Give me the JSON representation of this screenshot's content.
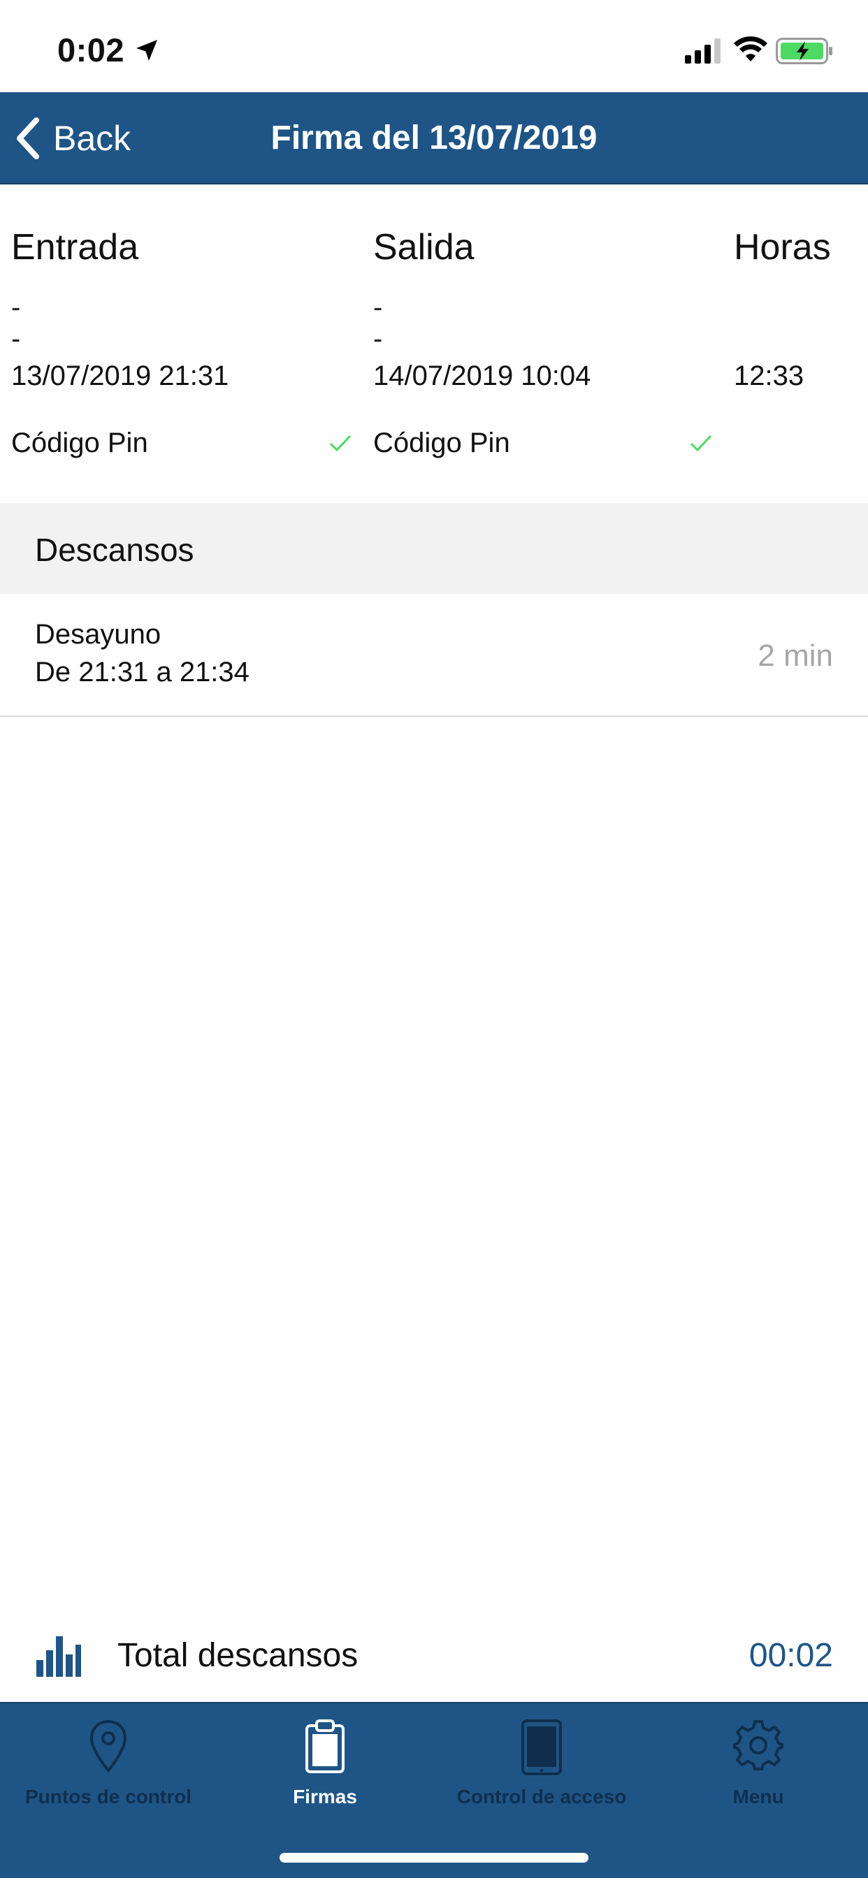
{
  "status_bar": {
    "time": "0:02"
  },
  "nav": {
    "back_label": "Back",
    "title": "Firma del 13/07/2019"
  },
  "entry": {
    "heading": "Entrada",
    "dash": "--",
    "datetime": "13/07/2019 21:31",
    "method": "Código Pin"
  },
  "exit": {
    "heading": "Salida",
    "dash": "--",
    "datetime": "14/07/2019 10:04",
    "method": "Código Pin"
  },
  "hours": {
    "heading": "Horas",
    "value": "12:33"
  },
  "breaks": {
    "section_title": "Descansos",
    "items": [
      {
        "name": "Desayuno",
        "range": "De 21:31 a 21:34",
        "duration": "2 min"
      }
    ]
  },
  "totals": {
    "label": "Total descansos",
    "value": "00:02"
  },
  "tabs": [
    {
      "label": "Puntos de control",
      "icon": "location-pin-icon",
      "active": false
    },
    {
      "label": "Firmas",
      "icon": "clipboard-icon",
      "active": true
    },
    {
      "label": "Control de acceso",
      "icon": "tablet-icon",
      "active": false
    },
    {
      "label": "Menu",
      "icon": "gear-icon",
      "active": false
    }
  ],
  "colors": {
    "primary": "#1f5586",
    "check": "#4cd964",
    "muted": "#a6a6a6",
    "tab_inactive": "#0f2f4d"
  }
}
